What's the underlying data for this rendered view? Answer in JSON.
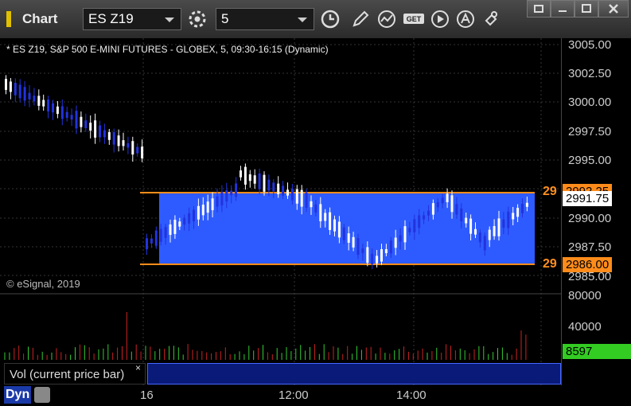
{
  "toolbar": {
    "app_title": "Chart",
    "symbol": "ES Z19",
    "interval": "5"
  },
  "chart": {
    "title": "* ES Z19, S&P 500 E-MINI FUTURES - GLOBEX, 5, 09:30-16:15 (Dynamic)",
    "copyright": "© eSignal, 2019",
    "price_ticks": [
      "3005.00",
      "3002.50",
      "3000.00",
      "2997.50",
      "2995.00",
      "2990.00",
      "2987.50",
      "2985.00"
    ],
    "current_price": "2991.75",
    "range_low_label": "2986.00",
    "range_high_label": "2992.25",
    "side_label_top": "29",
    "side_label_bottom": "29",
    "colors": {
      "range_fill": "#2e5bff",
      "range_line": "#ff8c1a",
      "up": "#ffffff",
      "down": "#2233dd"
    }
  },
  "volume": {
    "label": "Vol (current price bar)",
    "ticks": [
      "80000",
      "40000"
    ],
    "current_value": "8597",
    "close_glyph": "×"
  },
  "xaxis": {
    "labels": [
      "16",
      "12:00",
      "14:00"
    ]
  },
  "footer": {
    "dyn_label": "Dyn"
  }
}
